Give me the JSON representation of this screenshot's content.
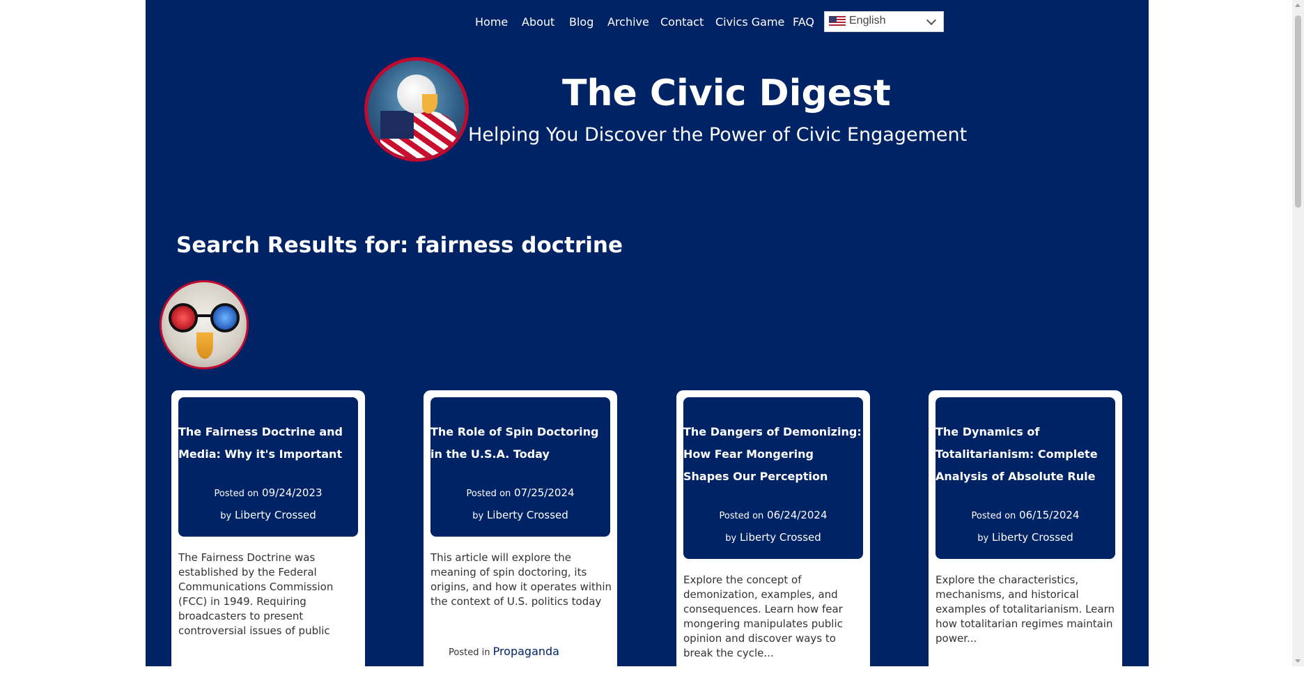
{
  "nav": {
    "items": [
      {
        "label": "Home"
      },
      {
        "label": "About"
      },
      {
        "label": "Blog"
      },
      {
        "label": "Archive"
      },
      {
        "label": "Contact"
      },
      {
        "label": "Civics Game"
      },
      {
        "label": "FAQ"
      }
    ],
    "language": {
      "selected": "English",
      "icon": "us-flag-icon"
    }
  },
  "header": {
    "title": "The Civic Digest",
    "tagline": "Helping You Discover the Power of Civic Engagement"
  },
  "search": {
    "heading": "Search Results for:  fairness doctrine"
  },
  "cards": [
    {
      "title": "The Fairness Doctrine and Media: Why it's Important",
      "posted_label": "Posted on",
      "date": "09/24/2023",
      "by_label": "by",
      "author": "Liberty Crossed",
      "excerpt": "The Fairness Doctrine was established by the Federal Communications Commission (FCC) in 1949. Requiring broadcasters to present controversial issues of public",
      "category_label": "",
      "category": ""
    },
    {
      "title": "The Role of Spin Doctoring in the U.S.A. Today",
      "posted_label": "Posted on",
      "date": "07/25/2024",
      "by_label": "by",
      "author": "Liberty Crossed",
      "excerpt": "This article will explore the meaning of spin doctoring, its origins, and how it operates within the context of U.S. politics today",
      "category_label": "Posted in",
      "category": "Propaganda"
    },
    {
      "title": "The Dangers of Demonizing: How Fear Mongering Shapes Our Perception",
      "posted_label": "Posted on",
      "date": "06/24/2024",
      "by_label": "by",
      "author": "Liberty Crossed",
      "excerpt": "Explore the concept of demonization, examples, and consequences. Learn how fear mongering manipulates public opinion and discover ways to break the cycle...",
      "category_label": "",
      "category": ""
    },
    {
      "title": "The Dynamics of Totalitarianism: Complete Analysis of Absolute Rule",
      "posted_label": "Posted on",
      "date": "06/15/2024",
      "by_label": "by",
      "author": "Liberty Crossed",
      "excerpt": "Explore the characteristics, mechanisms, and historical examples of totalitarianism. Learn how totalitarian regimes maintain power...",
      "category_label": "",
      "category": ""
    }
  ],
  "colors": {
    "page_background": "#002366",
    "outer_background": "#ffffff",
    "accent_red": "#bf0a30",
    "card_background": "#ffffff",
    "text_light": "#ffffff",
    "text_dark": "#333333"
  }
}
